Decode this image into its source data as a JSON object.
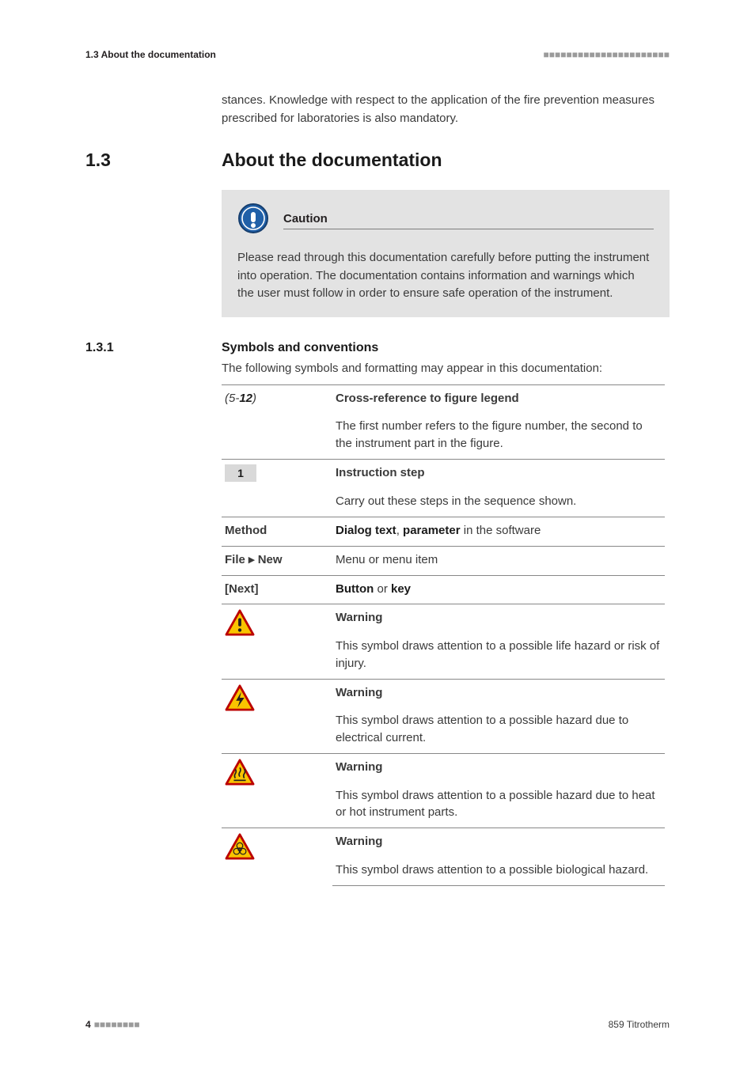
{
  "header": {
    "left": "1.3 About the documentation",
    "dashes": "■■■■■■■■■■■■■■■■■■■■■■"
  },
  "intro_continuation": "stances. Knowledge with respect to the application of the fire prevention measures prescribed for laboratories is also mandatory.",
  "section": {
    "num": "1.3",
    "title": "About the documentation"
  },
  "caution": {
    "title": "Caution",
    "body": "Please read through this documentation carefully before putting the instrument into operation. The documentation contains information and warnings which the user must follow in order to ensure safe operation of the instrument."
  },
  "subsection": {
    "num": "1.3.1",
    "title": "Symbols and conventions",
    "intro": "The following symbols and formatting may appear in this documentation:"
  },
  "table": {
    "r1": {
      "left_pre": "(5-",
      "left_bold": "12",
      "left_post": ")",
      "head": "Cross-reference to figure legend",
      "body": "The first number refers to the figure number, the second to the instrument part in the figure."
    },
    "r2": {
      "left": "1",
      "head": "Instruction step",
      "body": "Carry out these steps in the sequence shown."
    },
    "r3": {
      "left": "Method",
      "b1": "Dialog text",
      "mid": ", ",
      "b2": "parameter",
      "post": " in the software"
    },
    "r4": {
      "left": "File ▸ New",
      "body": "Menu or menu item"
    },
    "r5": {
      "left": "[Next]",
      "b1": "Button",
      "mid": " or ",
      "b2": "key"
    },
    "r6": {
      "head": "Warning",
      "body": "This symbol draws attention to a possible life hazard or risk of injury."
    },
    "r7": {
      "head": "Warning",
      "body": "This symbol draws attention to a possible hazard due to electrical current."
    },
    "r8": {
      "head": "Warning",
      "body": "This symbol draws attention to a possible hazard due to heat or hot instrument parts."
    },
    "r9": {
      "head": "Warning",
      "body": "This symbol draws attention to a possible biological hazard."
    }
  },
  "footer": {
    "page": "4",
    "dashes": "■■■■■■■■",
    "product": "859 Titrotherm"
  }
}
